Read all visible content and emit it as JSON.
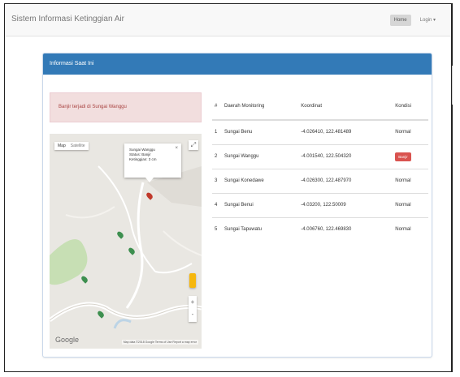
{
  "navbar": {
    "brand": "Sistem Informasi Ketinggian Air",
    "buttons": [
      {
        "label": "Home",
        "active": true
      },
      {
        "label": "Login ▾",
        "active": false
      }
    ]
  },
  "panel": {
    "heading": "Informasi Saat Ini"
  },
  "alert": {
    "text": "Banjir terjadi di Sungai Wanggu"
  },
  "map": {
    "type_buttons": [
      "Map",
      "Satellite"
    ],
    "info_window": {
      "line1": "Sungai Wanggu",
      "line2": "Status: Banjir",
      "line3": "Ketinggian: 3 cm"
    },
    "google_logo": "Google",
    "attribution": "Map data ©2018 Google   Terms of Use   Report a map error",
    "fullscreen_icon": "fullscreen-icon",
    "zoom_in": "+",
    "zoom_out": "-"
  },
  "table": {
    "headers": [
      "#",
      "Daerah Monitoring",
      "Koordinat",
      "Kondisi"
    ],
    "rows": [
      {
        "no": "1",
        "daerah": "Sungai Benu",
        "koordinat": "-4.026410, 122.481489",
        "kondisi": "Normal",
        "alert": false
      },
      {
        "no": "2",
        "daerah": "Sungai Wanggu",
        "koordinat": "-4.001540, 122.504320",
        "kondisi": "Banjir",
        "alert": true
      },
      {
        "no": "3",
        "daerah": "Sungai Konedawe",
        "koordinat": "-4.026300, 122.487970",
        "kondisi": "Normal",
        "alert": false
      },
      {
        "no": "4",
        "daerah": "Sungai Benui",
        "koordinat": "-4.03200, 122.50009",
        "kondisi": "Normal",
        "alert": false
      },
      {
        "no": "5",
        "daerah": "Sungai Tapuwatu",
        "koordinat": "-4.006760, 122.469830",
        "kondisi": "Normal",
        "alert": false
      }
    ]
  },
  "colors": {
    "panel_heading": "#337ab7",
    "alert_bg": "#f2dede",
    "alert_text": "#a94442",
    "badge": "#d9534f",
    "marker_normal": "#3d8f4f",
    "marker_alert": "#c0392b"
  }
}
